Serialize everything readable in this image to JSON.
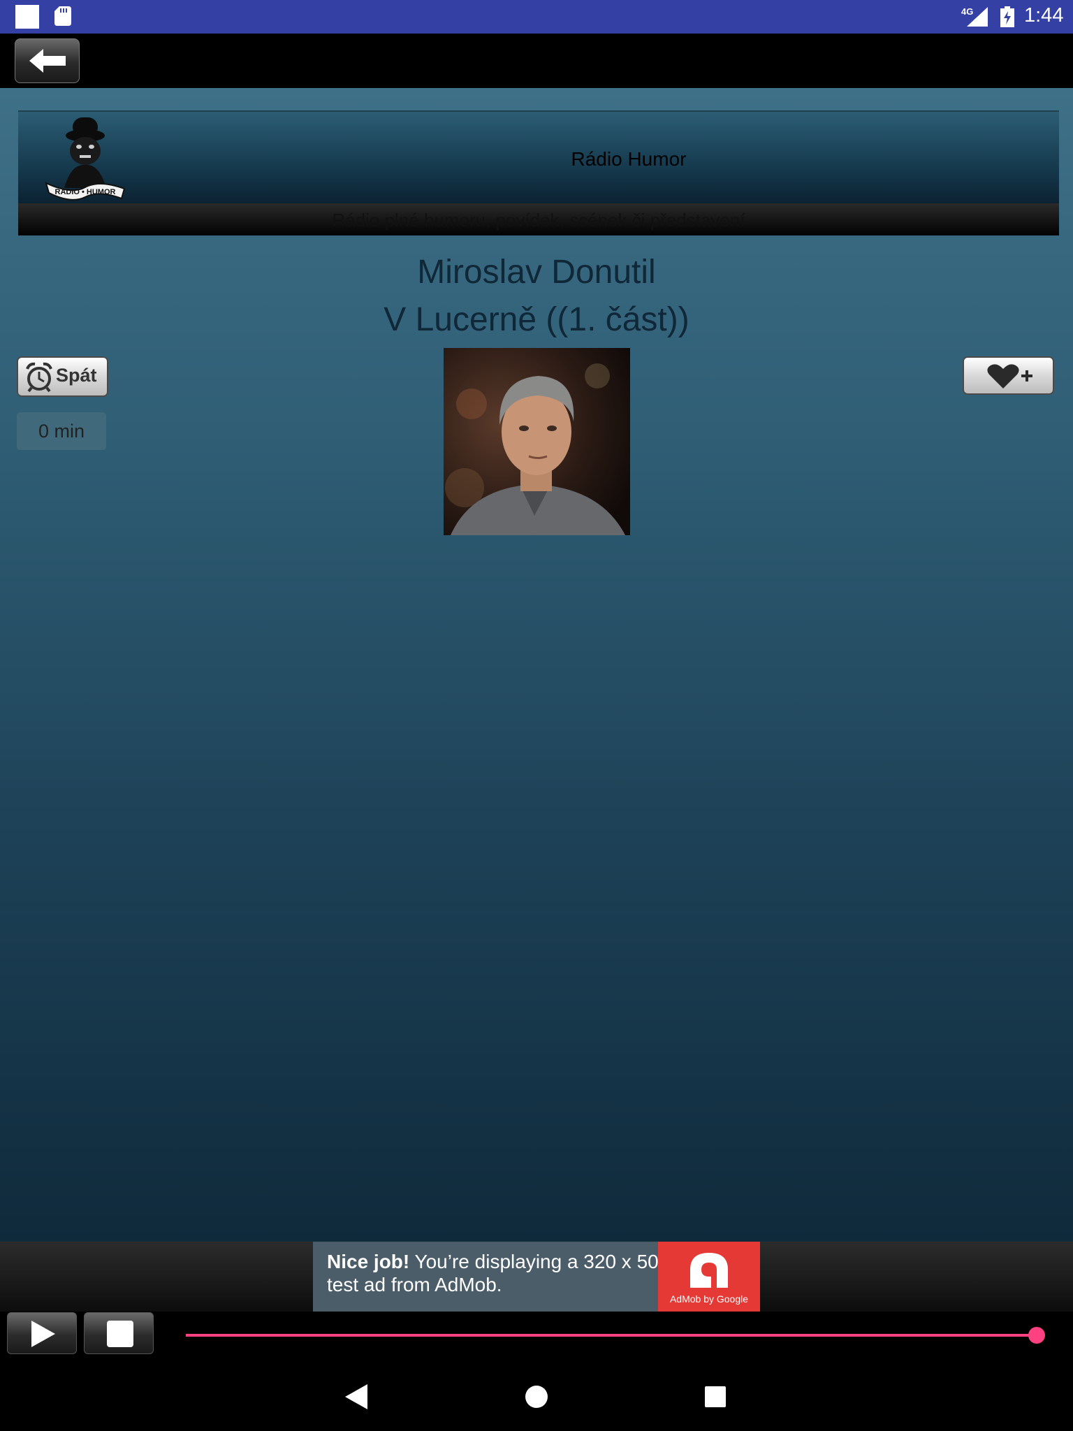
{
  "status_bar": {
    "network": "4G",
    "time": "1:44"
  },
  "header": {
    "title": "Rádio Humor",
    "subtitle": "Rádio plné humoru, povídek, scének či představení",
    "logo_text": "RADIO • HUMOR"
  },
  "now_playing": {
    "artist": "Miroslav Donutil",
    "track": "V Lucerně ((1. část))"
  },
  "sleep": {
    "label": "Spát",
    "timer": "0 min"
  },
  "ad": {
    "headline": "Nice job!",
    "body": " You’re displaying a 320 x 50 test ad from AdMob.",
    "brand": "AdMob by Google"
  },
  "player": {
    "progress": 1.0
  },
  "colors": {
    "accent": "#ff4081",
    "status_bar": "#3440a4",
    "ad_red": "#e53935"
  }
}
